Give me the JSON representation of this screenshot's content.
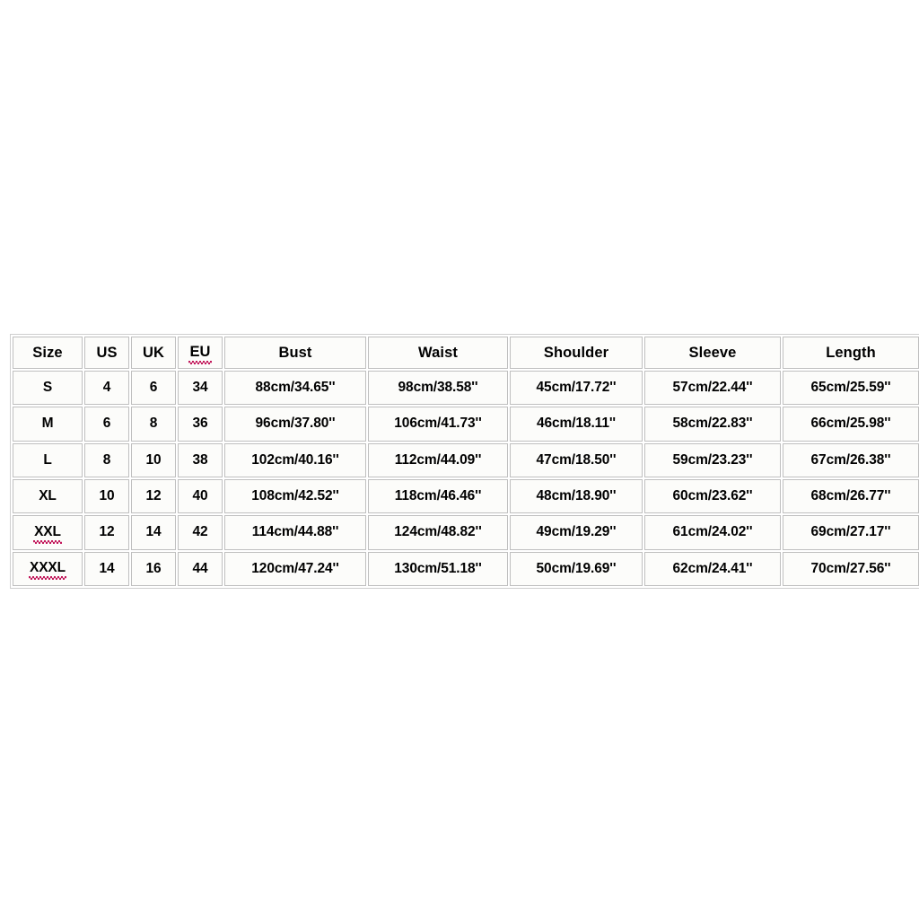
{
  "table": {
    "name": "garment-size-chart",
    "columns": [
      {
        "key": "size",
        "label": "Size",
        "misspelled": false
      },
      {
        "key": "us",
        "label": "US",
        "misspelled": false
      },
      {
        "key": "uk",
        "label": "UK",
        "misspelled": false
      },
      {
        "key": "eu",
        "label": "EU",
        "misspelled": true
      },
      {
        "key": "bust",
        "label": "Bust",
        "misspelled": false
      },
      {
        "key": "waist",
        "label": "Waist",
        "misspelled": false
      },
      {
        "key": "shoulder",
        "label": "Shoulder",
        "misspelled": false
      },
      {
        "key": "sleeve",
        "label": "Sleeve",
        "misspelled": false
      },
      {
        "key": "length",
        "label": "Length",
        "misspelled": false
      }
    ],
    "rows": [
      {
        "size": "S",
        "size_misspelled": false,
        "us": "4",
        "uk": "6",
        "eu": "34",
        "bust": "88cm/34.65''",
        "waist": "98cm/38.58''",
        "shoulder": "45cm/17.72''",
        "sleeve": "57cm/22.44''",
        "length": "65cm/25.59''"
      },
      {
        "size": "M",
        "size_misspelled": false,
        "us": "6",
        "uk": "8",
        "eu": "36",
        "bust": "96cm/37.80''",
        "waist": "106cm/41.73''",
        "shoulder": "46cm/18.11''",
        "sleeve": "58cm/22.83''",
        "length": "66cm/25.98''"
      },
      {
        "size": "L",
        "size_misspelled": false,
        "us": "8",
        "uk": "10",
        "eu": "38",
        "bust": "102cm/40.16''",
        "waist": "112cm/44.09''",
        "shoulder": "47cm/18.50''",
        "sleeve": "59cm/23.23''",
        "length": "67cm/26.38''"
      },
      {
        "size": "XL",
        "size_misspelled": false,
        "us": "10",
        "uk": "12",
        "eu": "40",
        "bust": "108cm/42.52''",
        "waist": "118cm/46.46''",
        "shoulder": "48cm/18.90''",
        "sleeve": "60cm/23.62''",
        "length": "68cm/26.77''"
      },
      {
        "size": "XXL",
        "size_misspelled": true,
        "us": "12",
        "uk": "14",
        "eu": "42",
        "bust": "114cm/44.88''",
        "waist": "124cm/48.82''",
        "shoulder": "49cm/19.29''",
        "sleeve": "61cm/24.02''",
        "length": "69cm/27.17''"
      },
      {
        "size": "XXXL",
        "size_misspelled": true,
        "us": "14",
        "uk": "16",
        "eu": "44",
        "bust": "120cm/47.24''",
        "waist": "130cm/51.18''",
        "shoulder": "50cm/19.69''",
        "sleeve": "62cm/24.41''",
        "length": "70cm/27.56''"
      }
    ]
  },
  "colors": {
    "page_background": "#ffffff",
    "cell_background": "#fcfcfa",
    "cell_border": "#bfbfbf",
    "table_border": "#cfcfcf",
    "text": "#000000",
    "spellcheck_underline": "#c2185b"
  }
}
